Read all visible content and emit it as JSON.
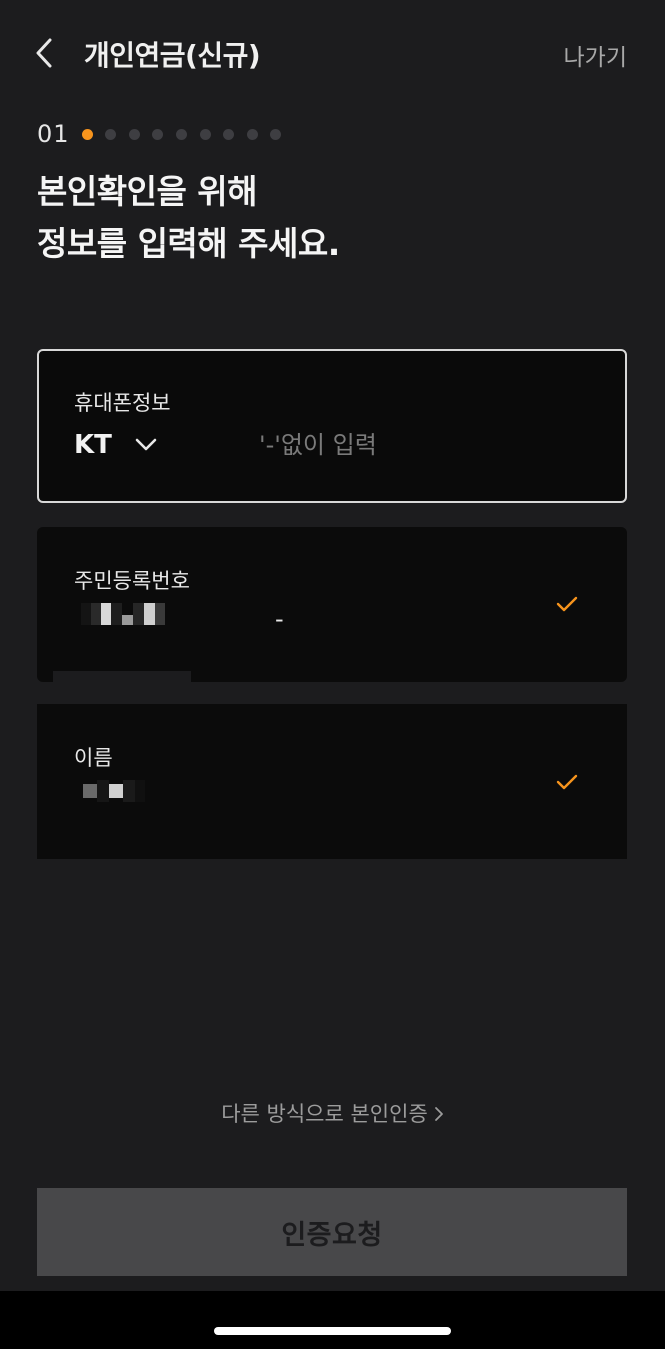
{
  "header": {
    "title": "개인연금(신규)",
    "exit_label": "나가기",
    "back_icon": "chevron-left-icon"
  },
  "progress": {
    "step_label": "01",
    "current_step": 1,
    "total_steps": 9,
    "active_color": "#f7941d",
    "inactive_color": "#3e3e42"
  },
  "headline": {
    "line1": "본인확인을 위해",
    "line2": "정보를 입력해 주세요."
  },
  "form": {
    "phone": {
      "label": "휴대폰정보",
      "carrier": "KT",
      "carrier_icon": "chevron-down-icon",
      "placeholder": "'-'없이 입력",
      "value": ""
    },
    "rrn": {
      "label": "주민등록번호",
      "separator": "-",
      "verified": true,
      "check_color": "#f7941d"
    },
    "name": {
      "label": "이름",
      "verified": true,
      "check_color": "#f7941d"
    }
  },
  "alt_verification": {
    "label": "다른 방식으로 본인인증",
    "icon": "chevron-right-icon"
  },
  "submit": {
    "label": "인증요청",
    "enabled": false
  }
}
